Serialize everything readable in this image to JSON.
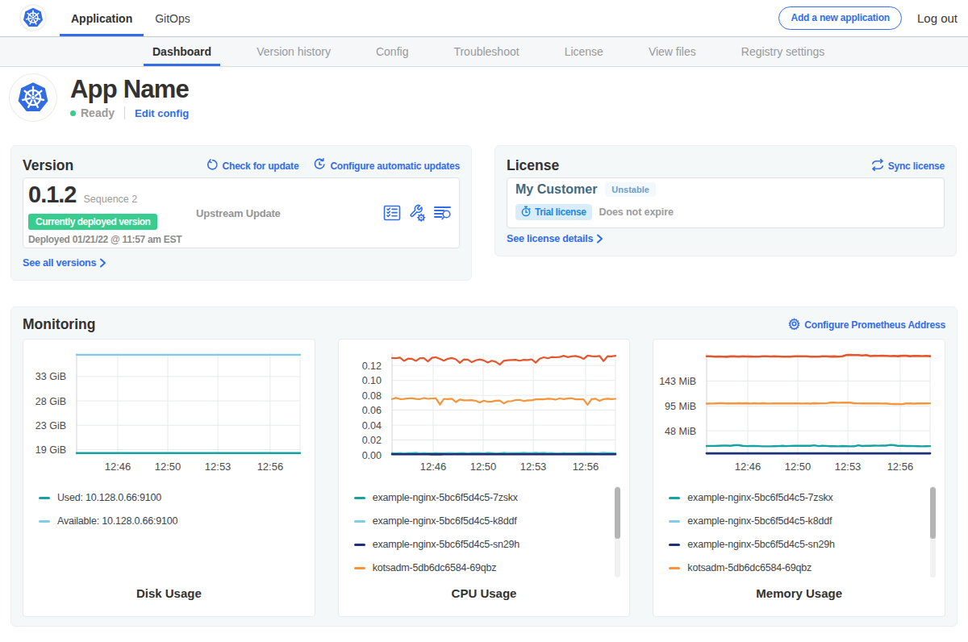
{
  "colors": {
    "blue": "#326DE6",
    "k8s_blue": "#326CE5",
    "green": "#38cc8e",
    "teal": "#17a2a2",
    "light_blue": "#7fcce8",
    "navy": "#1c3177",
    "orange": "#f7953b",
    "red_orange": "#e4572e",
    "text_dark": "#323232",
    "text_gray": "#959595"
  },
  "topbar": {
    "tabs": [
      {
        "label": "Application",
        "active": true
      },
      {
        "label": "GitOps",
        "active": false
      }
    ],
    "add_app_button": "Add a new application",
    "logout_label": "Log out"
  },
  "subnav": {
    "active": "Dashboard",
    "items": [
      "Dashboard",
      "Version history",
      "Config",
      "Troubleshoot",
      "License",
      "View files",
      "Registry settings"
    ]
  },
  "app_header": {
    "title": "App Name",
    "status": "Ready",
    "edit_config_label": "Edit config"
  },
  "version_card": {
    "title": "Version",
    "check_update_label": "Check for update",
    "auto_update_label": "Configure automatic updates",
    "version_number": "0.1.2",
    "sequence_label": "Sequence 2",
    "deployed_badge": "Currently deployed version",
    "deployed_at": "Deployed 01/21/22 @ 11:57 am EST",
    "upstream_label": "Upstream Update",
    "see_all_label": "See all versions"
  },
  "license_card": {
    "title": "License",
    "sync_label": "Sync license",
    "customer_name": "My Customer",
    "channel_badge": "Unstable",
    "type_badge": "Trial license",
    "expiry_text": "Does not expire",
    "details_label": "See license details"
  },
  "monitoring": {
    "title": "Monitoring",
    "configure_label": "Configure Prometheus Address"
  },
  "chart_data": [
    {
      "type": "line",
      "title": "Disk Usage",
      "xlabel": "",
      "ylabel": "",
      "x_tick_labels": [
        "12:46",
        "12:50",
        "12:53",
        "12:56"
      ],
      "x_tick_fractions": [
        0.184,
        0.408,
        0.632,
        0.866
      ],
      "ylim": [
        17.6,
        37.0
      ],
      "yticks": [
        {
          "value": 18.6,
          "label": "19 GiB"
        },
        {
          "value": 23.25,
          "label": "23 GiB"
        },
        {
          "value": 27.9,
          "label": "28 GiB"
        },
        {
          "value": 32.55,
          "label": "33 GiB"
        }
      ],
      "grid": true,
      "legend_position": "below",
      "has_scrollbar": false,
      "series": [
        {
          "name": "Used: 10.128.0.66:9100",
          "color": "#17a2a2",
          "width": 2.4,
          "legend_visible": true,
          "values": [
            17.95,
            17.95
          ]
        },
        {
          "name": "Available: 10.128.0.66:9100",
          "color": "#7fcce8",
          "width": 2.2,
          "legend_visible": true,
          "values": [
            36.7,
            36.7
          ]
        }
      ]
    },
    {
      "type": "line",
      "title": "CPU Usage",
      "xlabel": "",
      "ylabel": "",
      "x_tick_labels": [
        "12:46",
        "12:50",
        "12:53",
        "12:56"
      ],
      "x_tick_fractions": [
        0.184,
        0.408,
        0.632,
        0.866
      ],
      "ylim": [
        0,
        0.1365
      ],
      "yticks": [
        {
          "value": 0.0,
          "label": "0.00"
        },
        {
          "value": 0.02,
          "label": "0.02"
        },
        {
          "value": 0.04,
          "label": "0.04"
        },
        {
          "value": 0.06,
          "label": "0.06"
        },
        {
          "value": 0.08,
          "label": "0.08"
        },
        {
          "value": 0.1,
          "label": "0.10"
        },
        {
          "value": 0.12,
          "label": "0.12"
        }
      ],
      "grid": true,
      "legend_position": "below",
      "has_scrollbar": true,
      "series": [
        {
          "name": "example-nginx-5bc6f5d4c5-7zskx",
          "color": "#17a2a2",
          "width": 2.6,
          "legend_visible": true,
          "values": [
            0.00216,
            0.00191,
            0.00201,
            0.00199,
            0.00219,
            0.00217,
            0.00226,
            0.00193,
            0.00207,
            0.00191,
            0.00199,
            0.0021,
            0.00191,
            0.00198,
            0.00216,
            0.00212,
            0.00199,
            0.00214,
            0.00222,
            0.0019,
            0.00222,
            0.00218,
            0.00204,
            0.00196,
            0.00228,
            0.00203,
            0.00194,
            0.00194,
            0.00224,
            0.00214,
            0.00222,
            0.00219,
            0.00211,
            0.00229,
            0.00205,
            0.00212,
            0.00223,
            0.00215,
            0.00224,
            0.00213,
            0.00218,
            0.00192,
            0.00199,
            0.00202,
            0.00193,
            0.00199,
            0.00194,
            0.00201,
            0.00215,
            0.00205,
            0.00205,
            0.00198,
            0.00201,
            0.00227,
            0.00216,
            0.00214,
            0.00197
          ]
        },
        {
          "name": "example-nginx-5bc6f5d4c5-k8ddf",
          "color": "#7fcce8",
          "width": 2.0,
          "legend_visible": true,
          "values": [
            0.00145,
            0.00133,
            0.00138,
            0.0015,
            0.00143,
            0.00141,
            0.00144,
            0.00147,
            0.00146,
            0.00135,
            0.00131,
            0.00136,
            0.00135,
            0.00134,
            0.00149,
            0.00148,
            0.00136,
            0.00143,
            0.00138,
            0.00148,
            0.00139,
            0.00135,
            0.00135,
            0.00141,
            0.00135,
            0.00142,
            0.00148,
            0.00138,
            0.00134,
            0.0015,
            0.0014,
            0.00132,
            0.00131,
            0.00132,
            0.00143,
            0.00146,
            0.00138,
            0.00131,
            0.00138,
            0.0015,
            0.00141,
            0.00149,
            0.00147,
            0.0013,
            0.00144,
            0.00144,
            0.00141,
            0.00135,
            0.00143,
            0.00132,
            0.00139,
            0.00139,
            0.00149,
            0.00148,
            0.00135,
            0.0014,
            0.00134
          ]
        },
        {
          "name": "example-nginx-5bc6f5d4c5-sn29h",
          "color": "#1c3177",
          "width": 2.6,
          "legend_visible": true,
          "values": [
            0.00088,
            0.00087,
            0.00076,
            0.00083,
            0.00082,
            0.00073,
            0.00085,
            0.00081,
            0.00086,
            0.00081,
            0.0007,
            0.00076,
            0.0007,
            0.00089,
            0.00088,
            0.00087,
            0.00076,
            0.00071,
            0.00088,
            0.00089,
            0.00072,
            0.0008,
            0.00071,
            0.00085,
            0.00085,
            0.00073,
            0.0008,
            0.00081,
            0.00075,
            0.00087,
            0.00078,
            0.00074,
            0.00081,
            0.00085,
            0.00074,
            0.00076,
            0.0009,
            0.00083,
            0.00079,
            0.0008,
            0.00072,
            0.00074,
            0.00077,
            0.00082,
            0.00075,
            0.00074,
            0.00071,
            0.00083,
            0.00075,
            0.00088,
            0.00087,
            0.00071,
            0.00075,
            0.00083,
            0.00074,
            0.00073,
            0.00089
          ]
        },
        {
          "name": "kotsadm-5db6dc6584-69qbz",
          "color": "#f7953b",
          "width": 2.2,
          "legend_visible": true,
          "values": [
            0.07508,
            0.07653,
            0.07494,
            0.07513,
            0.07587,
            0.07602,
            0.07522,
            0.07502,
            0.0764,
            0.07524,
            0.07587,
            0.07591,
            0.06753,
            0.07534,
            0.07494,
            0.0754,
            0.071,
            0.07443,
            0.07329,
            0.07328,
            0.07349,
            0.07254,
            0.07028,
            0.07278,
            0.07127,
            0.07168,
            0.07277,
            0.07298,
            0.06913,
            0.072,
            0.07231,
            0.07372,
            0.07384,
            0.07225,
            0.07335,
            0.07318,
            0.07462,
            0.07459,
            0.07464,
            0.07553,
            0.07515,
            0.0742,
            0.07587,
            0.07494,
            0.07559,
            0.07609,
            0.07464,
            0.07461,
            0.07459,
            0.0674,
            0.07489,
            0.07549,
            0.07249,
            0.07477,
            0.07554,
            0.07488,
            0.07528
          ]
        },
        {
          "name": "",
          "color": "#e4572e",
          "width": 2.2,
          "legend_visible": false,
          "values": [
            0.13017,
            0.12993,
            0.13068,
            0.12624,
            0.12926,
            0.12903,
            0.12633,
            0.12982,
            0.12992,
            0.12555,
            0.13042,
            0.13116,
            0.12904,
            0.12657,
            0.12913,
            0.1301,
            0.12835,
            0.12372,
            0.12825,
            0.1279,
            0.12447,
            0.12692,
            0.12825,
            0.12681,
            0.12403,
            0.1265,
            0.12501,
            0.1212,
            0.12641,
            0.12715,
            0.12748,
            0.12772,
            0.12651,
            0.12771,
            0.12748,
            0.12836,
            0.12397,
            0.12917,
            0.13105,
            0.12975,
            0.13142,
            0.13106,
            0.13142,
            0.13313,
            0.13129,
            0.13243,
            0.13282,
            0.13147,
            0.12881,
            0.13342,
            0.13249,
            0.1324,
            0.1329,
            0.12604,
            0.1325,
            0.13231,
            0.13315
          ]
        }
      ]
    },
    {
      "type": "line",
      "title": "Memory Usage",
      "xlabel": "",
      "ylabel": "",
      "x_tick_labels": [
        "12:46",
        "12:50",
        "12:53",
        "12:56"
      ],
      "x_tick_fractions": [
        0.184,
        0.408,
        0.632,
        0.866
      ],
      "ylim": [
        2,
        196
      ],
      "yticks": [
        {
          "value": 48,
          "label": "48 MiB"
        },
        {
          "value": 95,
          "label": "95 MiB"
        },
        {
          "value": 143,
          "label": "143 MiB"
        }
      ],
      "grid": true,
      "legend_position": "below",
      "has_scrollbar": true,
      "series": [
        {
          "name": "example-nginx-5bc6f5d4c5-7zskx",
          "color": "#17a2a2",
          "width": 2.4,
          "legend_visible": true,
          "values": [
            18.98,
            19.1,
            19.06,
            19.34,
            19.7,
            19.65,
            19.18,
            20.55,
            20.45,
            19.2,
            18.85,
            19.05,
            18.89,
            18.74,
            18.38,
            18.35,
            18.27,
            18.5,
            18.77,
            19.17,
            18.76,
            19.14,
            19.4,
            19.18,
            19.57,
            19.43,
            19.21,
            20.31,
            18.84,
            19.22,
            19.09,
            18.5,
            18.61,
            18.37,
            18.88,
            18.59,
            18.32,
            18.55,
            20.39,
            18.96,
            19.34,
            19.37,
            19.7,
            19.49,
            19.76,
            19.69,
            21.03,
            20.5,
            19.12,
            19.21,
            18.88,
            19.0,
            18.8,
            18.56,
            18.39,
            18.42,
            18.77
          ]
        },
        {
          "name": "example-nginx-5bc6f5d4c5-k8ddf",
          "color": "#7fcce8",
          "width": 2.0,
          "legend_visible": true,
          "values": [
            4.6,
            4.6
          ]
        },
        {
          "name": "example-nginx-5bc6f5d4c5-sn29h",
          "color": "#1c3177",
          "width": 2.8,
          "legend_visible": true,
          "values": [
            5.0,
            5.0
          ]
        },
        {
          "name": "kotsadm-5db6dc6584-69qbz",
          "color": "#f7953b",
          "width": 2.4,
          "legend_visible": true,
          "values": [
            99.82,
            99.95,
            100.06,
            100.49,
            100.57,
            100.02,
            100.31,
            100.12,
            100.58,
            100.23,
            100.55,
            99.89,
            100.58,
            99.94,
            100.57,
            100.01,
            99.89,
            100.15,
            100.38,
            100.05,
            100.28,
            100.21,
            100.11,
            100.26,
            100.0,
            100.37,
            99.8,
            100.54,
            100.23,
            100.38,
            100.39,
            101.94,
            101.69,
            101.46,
            101.93,
            101.66,
            101.65,
            100.48,
            100.38,
            100.04,
            100.05,
            100.13,
            100.12,
            100.04,
            99.9,
            100.14,
            99.15,
            98.94,
            99.12,
            98.89,
            100.04,
            100.24,
            99.8,
            100.03,
            100.14,
            100.26,
            100.32
          ]
        },
        {
          "name": "",
          "color": "#e4572e",
          "width": 2.6,
          "legend_visible": false,
          "values": [
            190.21,
            190.15,
            189.39,
            189.72,
            189.58,
            189.3,
            190.07,
            189.94,
            189.56,
            190.04,
            189.85,
            189.73,
            189.31,
            189.38,
            190.18,
            190.2,
            189.85,
            190.13,
            189.88,
            189.45,
            189.43,
            189.61,
            190.2,
            190.1,
            190.16,
            190.2,
            189.51,
            189.55,
            189.4,
            190.08,
            190.18,
            189.71,
            189.92,
            189.45,
            190.23,
            192.66,
            192.78,
            192.61,
            192.68,
            191.82,
            192.54,
            190.63,
            191.23,
            191.1,
            191.16,
            191.11,
            190.57,
            191.09,
            190.41,
            191.17,
            191.16,
            190.52,
            191.12,
            190.76,
            190.61,
            191.1,
            190.53
          ]
        }
      ]
    }
  ]
}
